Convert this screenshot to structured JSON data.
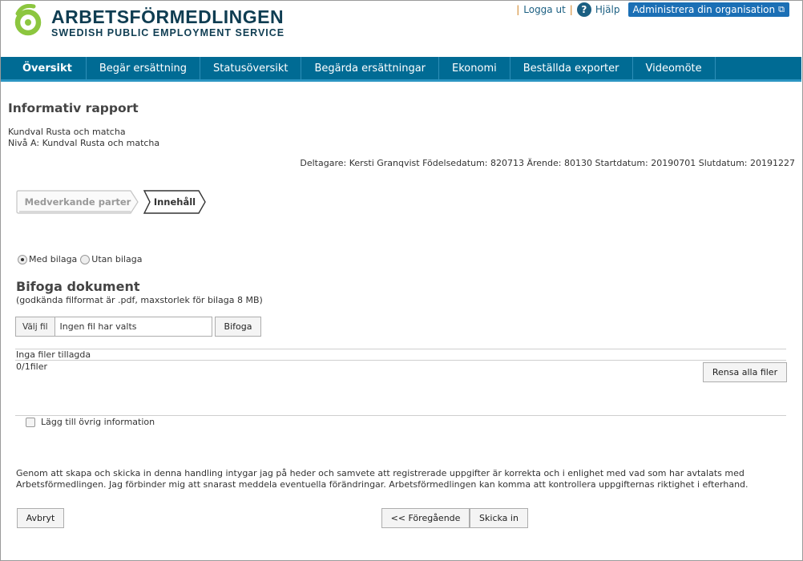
{
  "header": {
    "logo_name": "ARBETSFÖRMEDLINGEN",
    "logo_sub": "SWEDISH PUBLIC EMPLOYMENT SERVICE",
    "logout": "Logga ut",
    "help": "Hjälp",
    "admin": "Administrera din organisation",
    "colors": {
      "logo_green": "#8cc63f",
      "logo_text": "#0f3d52",
      "admin_bg": "#1b6fb5"
    }
  },
  "nav": {
    "items": [
      "Översikt",
      "Begär ersättning",
      "Statusöversikt",
      "Begärda ersättningar",
      "Ekonomi",
      "Beställda exporter",
      "Videomöte"
    ],
    "active": "Översikt",
    "color": "#006b94"
  },
  "page": {
    "title": "Informativ rapport",
    "kundval1": "Kundval Rusta och matcha",
    "kundval2": "Nivå A: Kundval Rusta och matcha",
    "deltagare": "Deltagare: Kersti Granqvist Födelsedatum: 820713 Ärende: 80130 Startdatum: 20190701 Slutdatum: 20191227"
  },
  "steps": {
    "step1": "Medverkande parter",
    "step2": "Innehåll",
    "active": "Innehåll"
  },
  "attachment_choice": {
    "with": "Med bilaga",
    "without": "Utan bilaga",
    "selected": "Med bilaga"
  },
  "upload": {
    "title": "Bifoga dokument",
    "subtitle": "(godkända filformat är .pdf, maxstorlek för bilaga 8 MB)",
    "choose_label": "Välj fil",
    "no_file": "Ingen fil har valts",
    "attach_label": "Bifoga",
    "no_files": "Inga filer tillagda",
    "count": "0/1filer",
    "clear_label": "Rensa alla filer"
  },
  "extra": {
    "checkbox_label": "Lägg till övrig information",
    "checked": false
  },
  "declaration": "Genom att skapa och skicka in denna handling intygar jag på heder och samvete att registrerade uppgifter är korrekta och i enlighet med vad som har avtalats med Arbetsförmedlingen. Jag förbinder mig att snarast meddela eventuella förändringar. Arbetsförmedlingen kan komma att kontrollera uppgifternas riktighet i efterhand.",
  "actions": {
    "cancel": "Avbryt",
    "previous": "<< Föregående",
    "submit": "Skicka in"
  }
}
